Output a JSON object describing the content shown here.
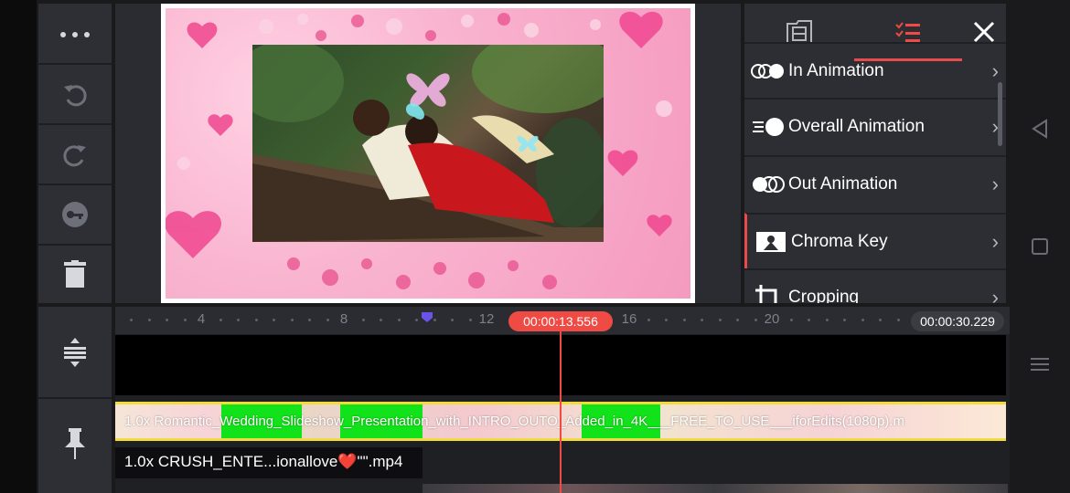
{
  "left_toolbar": {
    "items": [
      {
        "name": "more-icon",
        "label": "More"
      },
      {
        "name": "undo-icon",
        "label": "Undo"
      },
      {
        "name": "redo-icon",
        "label": "Redo"
      },
      {
        "name": "keyframe-icon",
        "label": "Keyframe"
      },
      {
        "name": "delete-icon",
        "label": "Delete"
      }
    ]
  },
  "panel": {
    "tabs": [
      {
        "name": "clip-tab",
        "icon": "film-icon",
        "active": false
      },
      {
        "name": "options-tab",
        "icon": "checklist-icon",
        "active": true
      }
    ],
    "close_icon": "close-icon",
    "menu": [
      {
        "label": "In Animation",
        "icon": "in-animation-icon"
      },
      {
        "label": "Overall Animation",
        "icon": "overall-animation-icon"
      },
      {
        "label": "Out Animation",
        "icon": "out-animation-icon"
      },
      {
        "label": "Chroma Key",
        "icon": "chroma-key-icon",
        "active": true
      },
      {
        "label": "Cropping",
        "icon": "crop-icon"
      }
    ]
  },
  "timeline": {
    "ruler_labels": [
      "4",
      "8",
      "12",
      "16",
      "20"
    ],
    "playhead_time": "00:00:13.556",
    "total_duration": "00:00:30.229",
    "main_clip_label": "1.0x Romantic_Wedding_Slideshow_Presentation_with_INTRO_OUTO_Added_in_4K___FREE_TO_USE___iforEdits(1080p).m",
    "overlay_clip_label": "1.0x CRUSH_ENTE...ionallove❤️\"\".mp4"
  },
  "timeline_tools": [
    {
      "name": "expand-timeline-icon"
    },
    {
      "name": "pin-icon"
    }
  ],
  "android_nav": [
    {
      "name": "back-icon"
    },
    {
      "name": "home-icon"
    },
    {
      "name": "recents-icon"
    }
  ],
  "colors": {
    "accent": "#ef4a43",
    "clip_border": "#f2dc3c",
    "chroma_green": "#12e21a",
    "panel_bg": "#2d2e33"
  }
}
